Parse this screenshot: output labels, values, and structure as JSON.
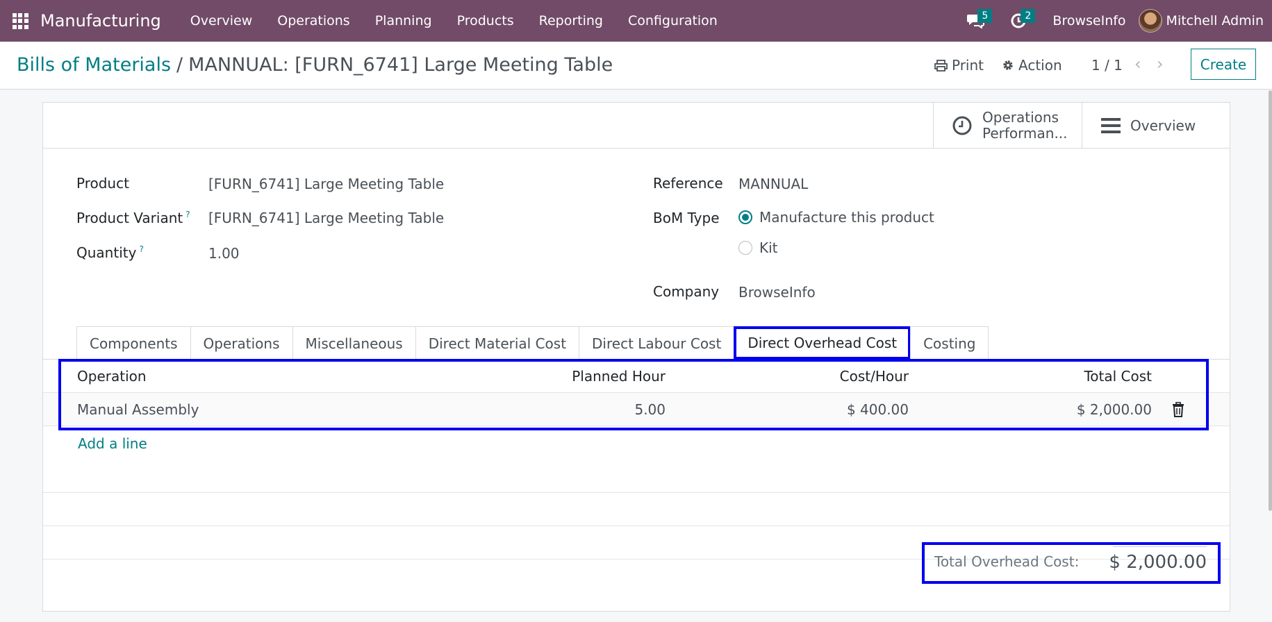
{
  "navbar": {
    "app_name": "Manufacturing",
    "menu": [
      "Overview",
      "Operations",
      "Planning",
      "Products",
      "Reporting",
      "Configuration"
    ],
    "messages_badge": "5",
    "activities_badge": "2",
    "company": "BrowseInfo",
    "user": "Mitchell Admin",
    "bg_color": "#714b67"
  },
  "breadcrumb": {
    "parent": "Bills of Materials",
    "separator": "/",
    "current": "MANNUAL: [FURN_6741] Large Meeting Table"
  },
  "controls": {
    "print": "Print",
    "action": "Action",
    "pager": "1 / 1",
    "create": "Create"
  },
  "stat_buttons": {
    "operations_line1": "Operations",
    "operations_line2": "Performan...",
    "overview": "Overview"
  },
  "form": {
    "product_label": "Product",
    "product_value": "[FURN_6741] Large Meeting Table",
    "variant_label": "Product Variant",
    "variant_value": "[FURN_6741] Large Meeting Table",
    "quantity_label": "Quantity",
    "quantity_value": "1.00",
    "help_mark": "?",
    "reference_label": "Reference",
    "reference_value": "MANNUAL",
    "bom_type_label": "BoM Type",
    "bom_type_options": [
      "Manufacture this product",
      "Kit"
    ],
    "bom_type_selected": "Manufacture this product",
    "company_label": "Company",
    "company_value": "BrowseInfo"
  },
  "tabs": [
    "Components",
    "Operations",
    "Miscellaneous",
    "Direct Material Cost",
    "Direct Labour Cost",
    "Direct Overhead Cost",
    "Costing"
  ],
  "active_tab": "Direct Overhead Cost",
  "table": {
    "headers": [
      "Operation",
      "Planned Hour",
      "Cost/Hour",
      "Total Cost"
    ],
    "rows": [
      {
        "operation": "Manual Assembly",
        "planned_hour": "5.00",
        "cost_hour": "$ 400.00",
        "total_cost": "$ 2,000.00"
      }
    ],
    "add_line": "Add a line"
  },
  "total": {
    "label": "Total Overhead Cost:",
    "value": "$ 2,000.00"
  },
  "colors": {
    "accent": "#017e84",
    "highlight": "#0000ee"
  }
}
